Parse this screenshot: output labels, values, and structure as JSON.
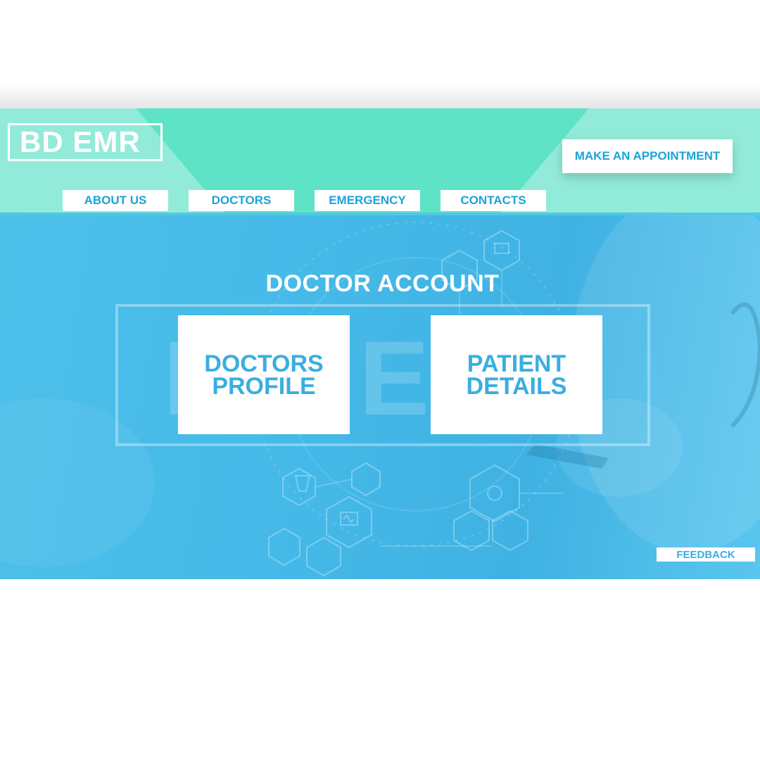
{
  "brand": {
    "logo_text": "BD EMR"
  },
  "header": {
    "appointment_label": "MAKE AN APPOINTMENT",
    "nav": [
      {
        "label": "ABOUT US"
      },
      {
        "label": "DOCTORS"
      },
      {
        "label": "EMERGENCY"
      },
      {
        "label": "CONTACTS"
      }
    ]
  },
  "main": {
    "title": "DOCTOR ACCOUNT",
    "cards": [
      {
        "label": "DOCTORS\nPROFILE"
      },
      {
        "label": "PATIENT\nDETAILS"
      }
    ],
    "feedback_label": "FEEDBACK"
  },
  "colors": {
    "header_bg": "#92ebd8",
    "header_accent": "#5fe3c7",
    "hero_blue": "#45b9e8",
    "text_blue": "#1ba3d8",
    "card_text_blue": "#3aaee0"
  }
}
